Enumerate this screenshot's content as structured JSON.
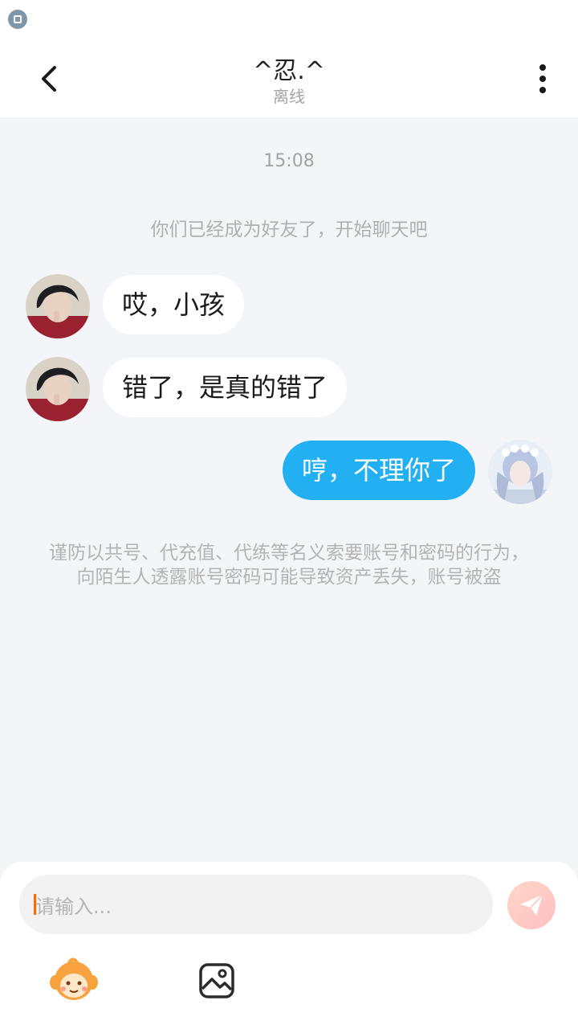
{
  "header": {
    "title": "^忍.^",
    "status": "离线"
  },
  "chat": {
    "timestamp": "15:08",
    "system_notice": "你们已经成为好友了，开始聊天吧",
    "messages": [
      {
        "from": "other",
        "text": "哎，小孩"
      },
      {
        "from": "other",
        "text": "错了，是真的错了"
      },
      {
        "from": "me",
        "text": "哼，不理你了"
      }
    ],
    "warning": "谨防以共号、代充值、代练等名义索要账号和密码的行为，向陌生人透露账号密码可能导致资产丢失，账号被盗"
  },
  "input": {
    "placeholder": "请输入..."
  },
  "icons": {
    "back": "back-arrow-icon",
    "more": "more-vertical-icon",
    "send": "paper-plane-icon",
    "emoji": "emoji-mascot-icon",
    "image": "image-picture-icon"
  },
  "colors": {
    "background": "#f3f5f8",
    "outgoing_bubble": "#22b0f2",
    "incoming_bubble": "#ffffff",
    "caret": "#ff6a00"
  }
}
